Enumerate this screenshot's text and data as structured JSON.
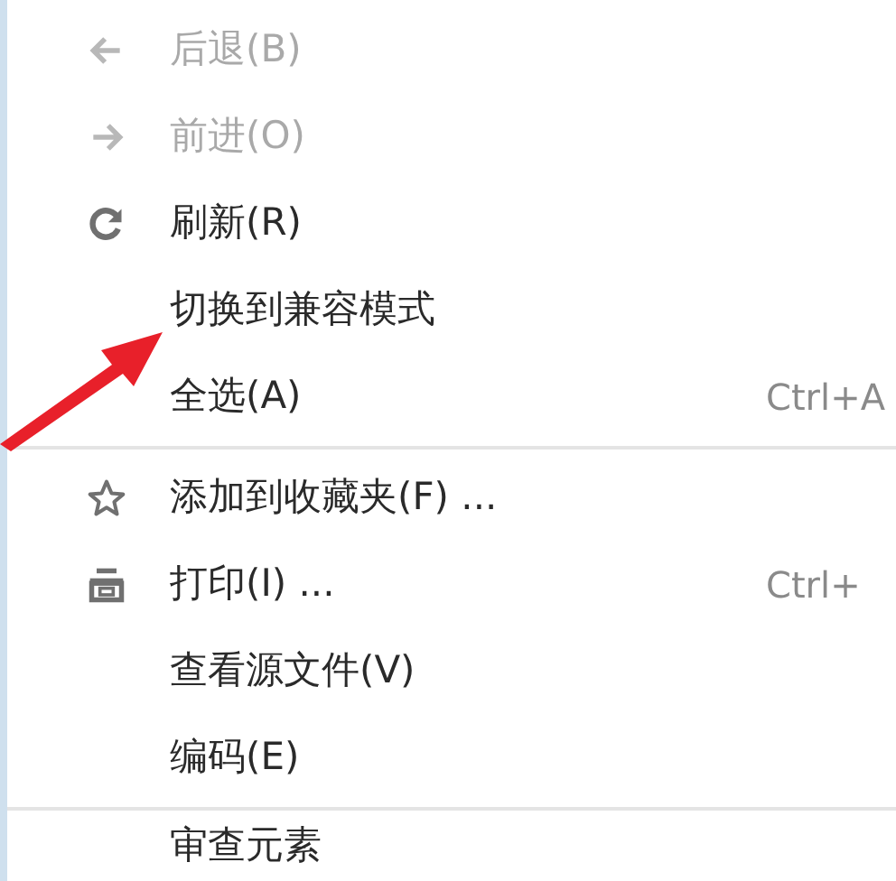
{
  "menu": {
    "items": [
      {
        "kind": "back",
        "label": "后退(B)",
        "disabled": true
      },
      {
        "kind": "forward",
        "label": "前进(O)",
        "disabled": true
      },
      {
        "kind": "refresh",
        "label": "刷新(R)",
        "disabled": false
      },
      {
        "kind": "item",
        "label": "切换到兼容模式",
        "disabled": false
      },
      {
        "kind": "item",
        "label": "全选(A)",
        "shortcut": "Ctrl+A",
        "disabled": false
      },
      {
        "kind": "divider"
      },
      {
        "kind": "star",
        "label": "添加到收藏夹(F) ...",
        "disabled": false
      },
      {
        "kind": "print",
        "label": "打印(I) ...",
        "shortcut": "Ctrl+",
        "disabled": false
      },
      {
        "kind": "item",
        "label": "查看源文件(V)",
        "disabled": false
      },
      {
        "kind": "item",
        "label": "编码(E)",
        "disabled": false
      },
      {
        "kind": "divider"
      },
      {
        "kind": "item",
        "label": "审查元素",
        "disabled": false
      }
    ]
  }
}
